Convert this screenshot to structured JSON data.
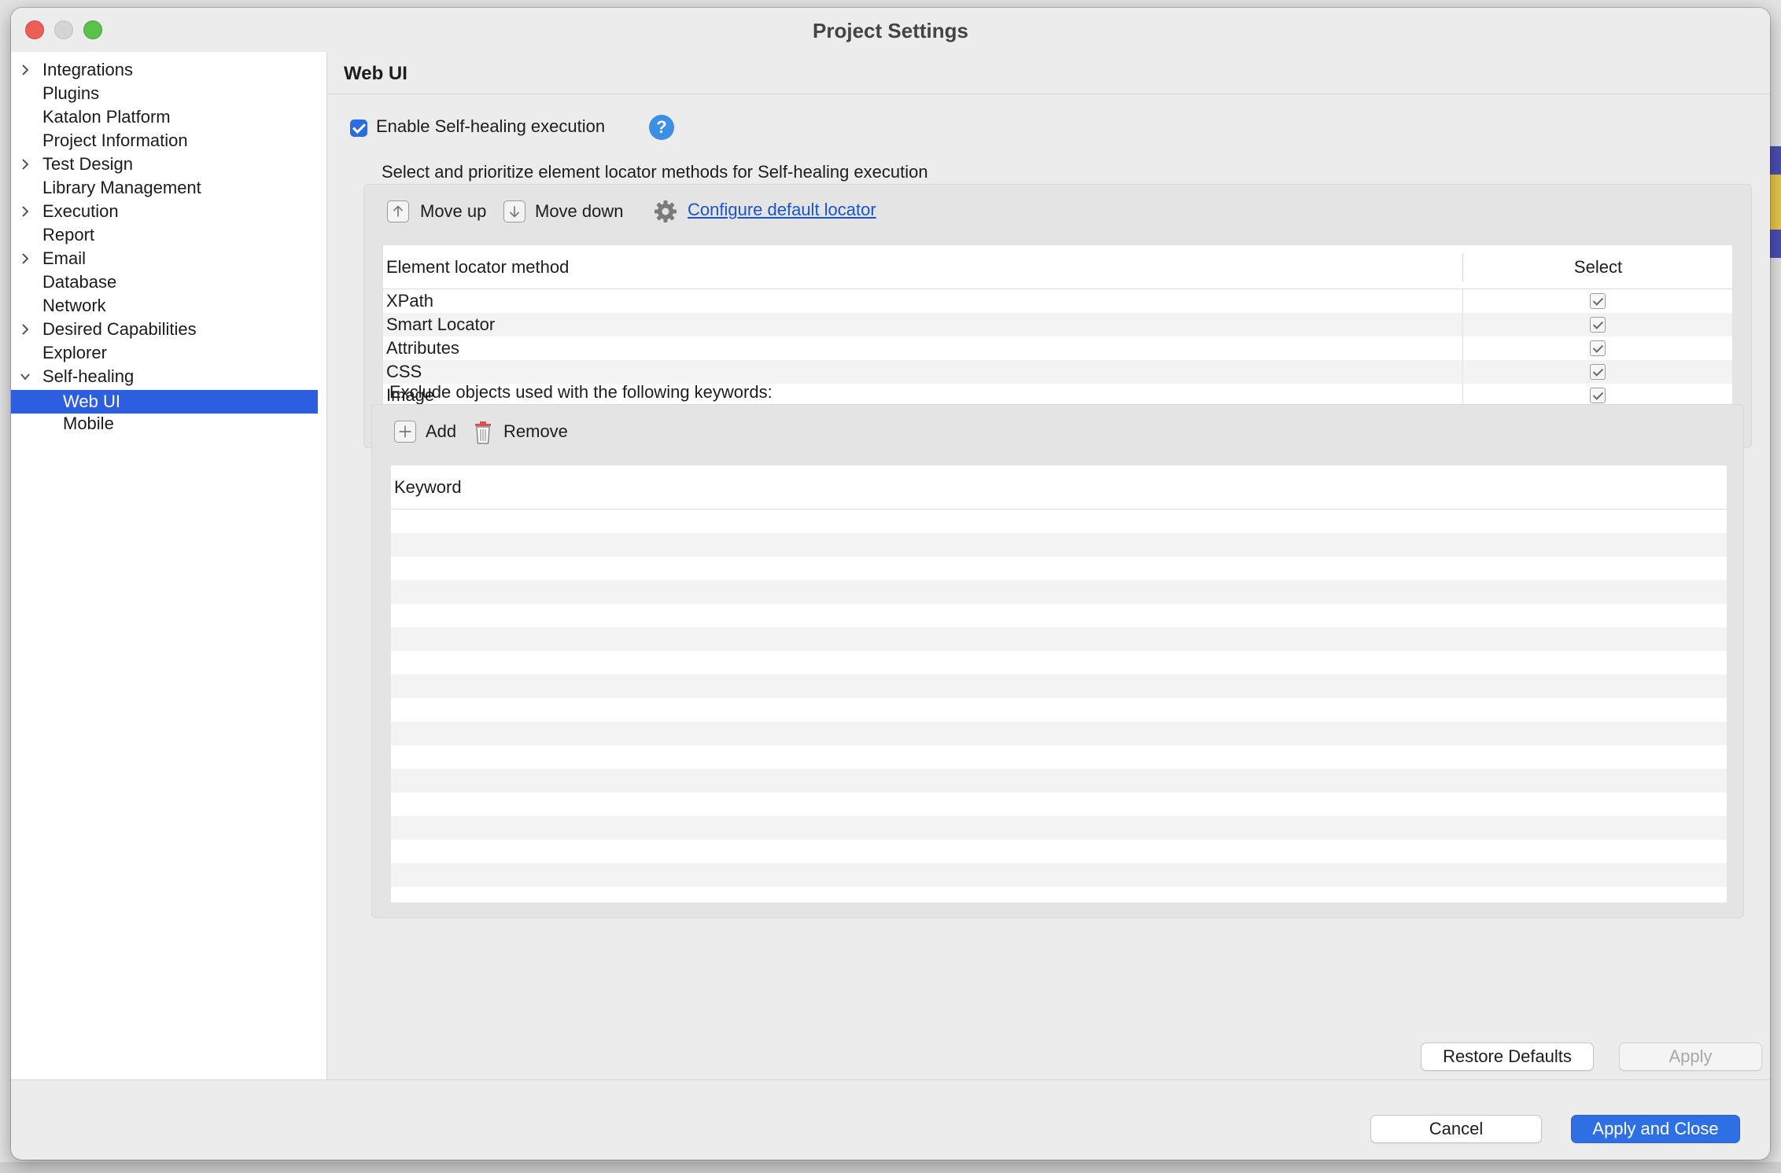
{
  "window": {
    "title": "Project Settings"
  },
  "sidebar": {
    "items": [
      {
        "label": "Integrations",
        "expandable": true
      },
      {
        "label": "Plugins",
        "expandable": false
      },
      {
        "label": "Katalon Platform",
        "expandable": false
      },
      {
        "label": "Project Information",
        "expandable": false
      },
      {
        "label": "Test Design",
        "expandable": true
      },
      {
        "label": "Library Management",
        "expandable": false
      },
      {
        "label": "Execution",
        "expandable": true
      },
      {
        "label": "Report",
        "expandable": false
      },
      {
        "label": "Email",
        "expandable": true
      },
      {
        "label": "Database",
        "expandable": false
      },
      {
        "label": "Network",
        "expandable": false
      },
      {
        "label": "Desired Capabilities",
        "expandable": true
      },
      {
        "label": "Explorer",
        "expandable": false
      },
      {
        "label": "Self-healing",
        "expandable": true,
        "expanded": true
      },
      {
        "label": "Web UI",
        "selected": true,
        "child": true
      },
      {
        "label": "Mobile",
        "child": true
      }
    ]
  },
  "page": {
    "title": "Web UI",
    "enable_self_healing": {
      "label": "Enable Self-healing execution",
      "checked": true
    },
    "locator_section": {
      "caption": "Select and prioritize element locator methods for Self-healing execution",
      "move_up": "Move up",
      "move_down": "Move down",
      "configure_link": "Configure default locator",
      "columns": [
        "Element locator method",
        "Select"
      ],
      "rows": [
        {
          "method": "XPath",
          "selected": true
        },
        {
          "method": "Smart Locator",
          "selected": true
        },
        {
          "method": "Attributes",
          "selected": true
        },
        {
          "method": "CSS",
          "selected": true
        },
        {
          "method": "Image",
          "selected": true
        }
      ]
    },
    "exclude_section": {
      "caption": "Exclude objects used with the following keywords:",
      "add": "Add",
      "remove": "Remove",
      "column": "Keyword",
      "rows": []
    },
    "restore_defaults": "Restore Defaults",
    "apply": "Apply"
  },
  "footer": {
    "cancel": "Cancel",
    "apply_and_close": "Apply and Close"
  },
  "colors": {
    "accent": "#2f6fe4",
    "selection": "#2d5ee0",
    "link": "#1a55c8"
  }
}
